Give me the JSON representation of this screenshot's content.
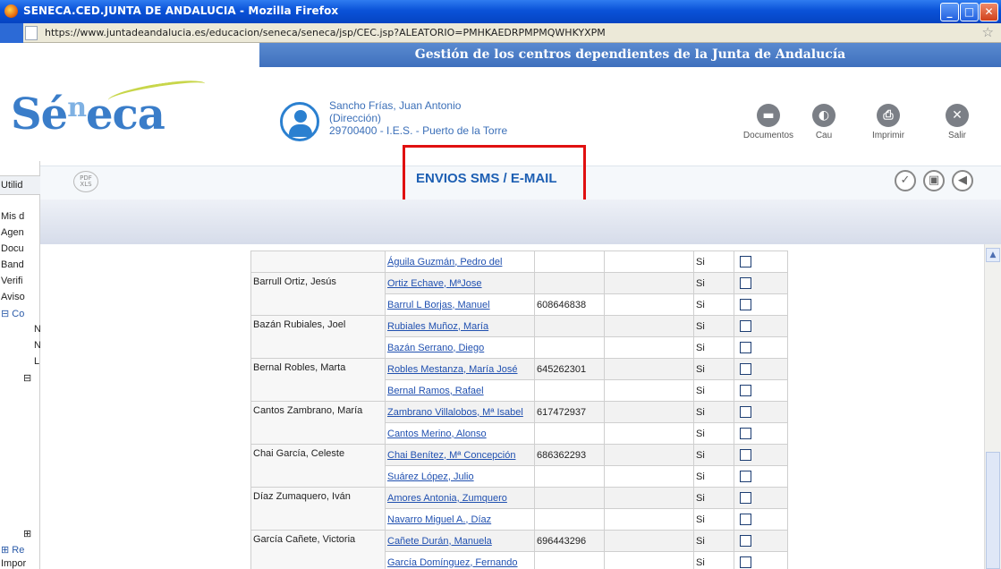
{
  "window": {
    "title": "SENECA.CED.JUNTA DE ANDALUCIA - Mozilla Firefox",
    "url": "https://www.juntadeandalucia.es/educacion/seneca/seneca/jsp/CEC.jsp?ALEATORIO=PMHKAEDRPMPMQWHKYXPM"
  },
  "banner": "Gestión de los centros dependientes de la Junta de Andalucía",
  "logo": {
    "main": "Sé",
    "sup": "n",
    "rest": "eca"
  },
  "user": {
    "name": "Sancho Frías, Juan Antonio",
    "role": "(Dirección)",
    "center": "29700400 - I.E.S. - Puerto de la Torre"
  },
  "top_buttons": [
    {
      "label": "Documentos",
      "icon": "documents-icon"
    },
    {
      "label": "Cau",
      "icon": "headset-icon"
    },
    {
      "label": "Imprimir",
      "icon": "print-icon"
    },
    {
      "label": "Salir",
      "icon": "close-icon"
    }
  ],
  "toolbar": {
    "pdf_label": "PDF XLS",
    "title": "ENVIOS SMS / E-MAIL"
  },
  "sidebar": {
    "header": "Utilid",
    "items": [
      "Mis d",
      "Agen",
      "Docu",
      "Band",
      "Verifi",
      "Aviso",
      "⊟ Co",
      "N",
      "N",
      "L",
      "⊟ ",
      "⊞",
      "⊞ Re",
      "Impor"
    ]
  },
  "table": {
    "rows": [
      {
        "alumno": "",
        "responsable": "Águila Guzmán, Pedro del",
        "telefono": "",
        "si": "Si"
      },
      {
        "alumno": "Barrull Ortiz, Jesús",
        "responsable": "Ortiz Echave, MªJose",
        "telefono": "",
        "si": "Si"
      },
      {
        "alumno": "",
        "responsable": "Barrul L Borjas, Manuel",
        "telefono": "608646838",
        "si": "Si"
      },
      {
        "alumno": "Bazán Rubiales, Joel",
        "responsable": "Rubiales Muñoz, María",
        "telefono": "",
        "si": "Si"
      },
      {
        "alumno": "",
        "responsable": "Bazán Serrano, Diego",
        "telefono": "",
        "si": "Si"
      },
      {
        "alumno": "Bernal Robles, Marta",
        "responsable": "Robles Mestanza, María José",
        "telefono": "645262301",
        "si": "Si"
      },
      {
        "alumno": "",
        "responsable": "Bernal Ramos, Rafael",
        "telefono": "",
        "si": "Si"
      },
      {
        "alumno": "Cantos Zambrano, María",
        "responsable": "Zambrano Villalobos, Mª Isabel",
        "telefono": "617472937",
        "si": "Si"
      },
      {
        "alumno": "",
        "responsable": "Cantos Merino, Alonso",
        "telefono": "",
        "si": "Si"
      },
      {
        "alumno": "Chai García, Celeste",
        "responsable": "Chai Benítez, Mª Concepción",
        "telefono": "686362293",
        "si": "Si"
      },
      {
        "alumno": "",
        "responsable": "Suárez López, Julio",
        "telefono": "",
        "si": "Si"
      },
      {
        "alumno": "Díaz Zumaquero, Iván",
        "responsable": "Amores Antonia, Zumquero",
        "telefono": "",
        "si": "Si"
      },
      {
        "alumno": "",
        "responsable": "Navarro Miguel A., Díaz",
        "telefono": "",
        "si": "Si"
      },
      {
        "alumno": "García Cañete, Victoria",
        "responsable": "Cañete Durán, Manuela",
        "telefono": "696443296",
        "si": "Si"
      },
      {
        "alumno": "",
        "responsable": "García Domínguez, Fernando",
        "telefono": "",
        "si": "Si"
      }
    ]
  }
}
